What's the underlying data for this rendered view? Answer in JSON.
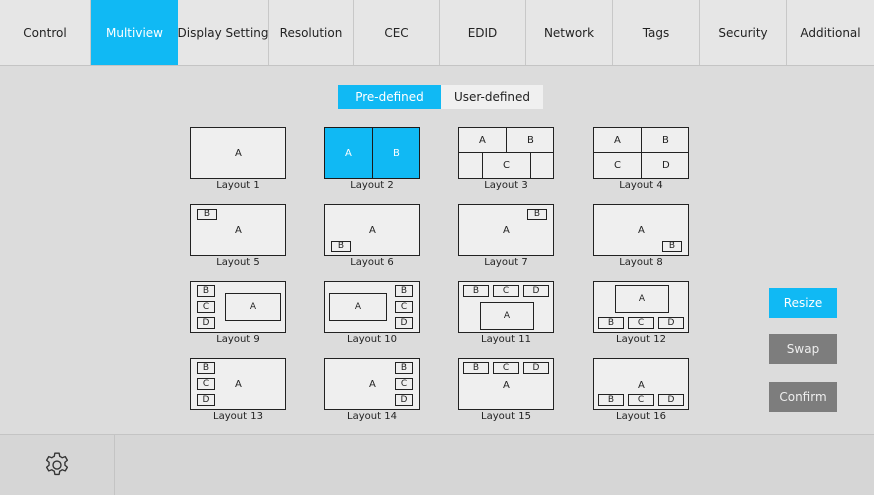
{
  "nav": {
    "tabs": [
      {
        "label": "Control",
        "active": false
      },
      {
        "label": "Multiview",
        "active": true
      },
      {
        "label": "Display Setting",
        "active": false
      },
      {
        "label": "Resolution",
        "active": false
      },
      {
        "label": "CEC",
        "active": false
      },
      {
        "label": "EDID",
        "active": false
      },
      {
        "label": "Network",
        "active": false
      },
      {
        "label": "Tags",
        "active": false
      },
      {
        "label": "Security",
        "active": false
      },
      {
        "label": "Additional",
        "active": false
      }
    ]
  },
  "subtabs": {
    "predefined": "Pre-defined",
    "userdefined": "User-defined",
    "active": "predefined"
  },
  "layouts": {
    "selected": 2,
    "items": [
      {
        "caption": "Layout 1",
        "windows": [
          "A"
        ]
      },
      {
        "caption": "Layout 2",
        "windows": [
          "A",
          "B"
        ]
      },
      {
        "caption": "Layout 3",
        "windows": [
          "A",
          "B",
          "C"
        ]
      },
      {
        "caption": "Layout 4",
        "windows": [
          "A",
          "B",
          "C",
          "D"
        ]
      },
      {
        "caption": "Layout 5",
        "windows": [
          "B",
          "A"
        ]
      },
      {
        "caption": "Layout 6",
        "windows": [
          "A",
          "B"
        ]
      },
      {
        "caption": "Layout 7",
        "windows": [
          "B",
          "A"
        ]
      },
      {
        "caption": "Layout 8",
        "windows": [
          "A",
          "B"
        ]
      },
      {
        "caption": "Layout 9",
        "windows": [
          "B",
          "C",
          "A",
          "D"
        ]
      },
      {
        "caption": "Layout 10",
        "windows": [
          "B",
          "A",
          "C",
          "D"
        ]
      },
      {
        "caption": "Layout 11",
        "windows": [
          "B",
          "C",
          "D",
          "A"
        ]
      },
      {
        "caption": "Layout 12",
        "windows": [
          "A",
          "B",
          "C",
          "D"
        ]
      },
      {
        "caption": "Layout 13",
        "windows": [
          "B",
          "C",
          "A",
          "D"
        ]
      },
      {
        "caption": "Layout 14",
        "windows": [
          "B",
          "A",
          "C",
          "D"
        ]
      },
      {
        "caption": "Layout 15",
        "windows": [
          "B",
          "C",
          "D",
          "A"
        ]
      },
      {
        "caption": "Layout 16",
        "windows": [
          "A",
          "B",
          "C",
          "D"
        ]
      }
    ]
  },
  "actions": {
    "resize": "Resize",
    "swap": "Swap",
    "confirm": "Confirm"
  },
  "icons": {
    "settings": "gear-icon"
  },
  "colors": {
    "accent": "#10b9f4",
    "button_inactive": "#7d7d7d",
    "background": "#dcdcdc"
  }
}
